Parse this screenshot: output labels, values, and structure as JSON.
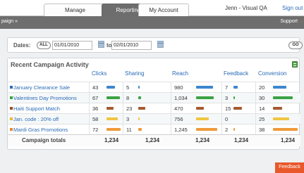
{
  "nav": {
    "tabs": [
      "Manage",
      "Reporting",
      "My Account"
    ],
    "user": "Jenn - Visual QA",
    "sign_out": "Sign out"
  },
  "crumbbar": {
    "breadcrumb": "paign »",
    "support": "Support"
  },
  "dates": {
    "label": "Dates:",
    "all_label": "ALL",
    "from": "01/01/2010",
    "to_label": "to:",
    "to": "02/01/2010",
    "go_label": "GO"
  },
  "activity": {
    "title": "Recent Campaign Activity",
    "columns": [
      "Clicks",
      "Sharing",
      "Reach",
      "Feedback",
      "Conversion"
    ],
    "campaigns": [
      {
        "name": "January Clearance Sale",
        "color": "#2d6fb5",
        "values": [
          "43",
          "5",
          "980",
          "7",
          "20"
        ],
        "bar_color": "#3d86cf"
      },
      {
        "name": "Valentines Day Promotions",
        "color": "#3aa344",
        "values": [
          "67",
          "8",
          "1,034",
          "3",
          "30"
        ],
        "bar_color": "#3aa344"
      },
      {
        "name": "Haiti Support Match",
        "color": "#9a4d25",
        "values": [
          "36",
          "23",
          "470",
          "15",
          "14"
        ],
        "bar_color": "#a55a30"
      },
      {
        "name": "Jan. code : 20% off",
        "color": "#e9b92a",
        "values": [
          "58",
          "3",
          "756",
          "0",
          "25"
        ],
        "bar_color": "#f0c540"
      },
      {
        "name": "Mardi Gras Promotions",
        "color": "#e8872b",
        "values": [
          "72",
          "11",
          "1,245",
          "2",
          "38"
        ],
        "bar_color": "#ef9a3a"
      }
    ],
    "bar_levels": [
      [
        0.43,
        0.22,
        0.79,
        0.47,
        0.53
      ],
      [
        0.67,
        0.35,
        0.83,
        0.2,
        0.79
      ],
      [
        0.36,
        1.0,
        0.38,
        1.0,
        0.37
      ],
      [
        0.58,
        0.13,
        0.61,
        0.0,
        0.66
      ],
      [
        0.72,
        0.48,
        1.0,
        0.13,
        1.0
      ]
    ],
    "totals": {
      "label": "Campaign totals",
      "values": [
        "1,234",
        "1,234",
        "1,234",
        "1,234",
        "1,234"
      ]
    }
  },
  "feedback_tab": "Feedback"
}
